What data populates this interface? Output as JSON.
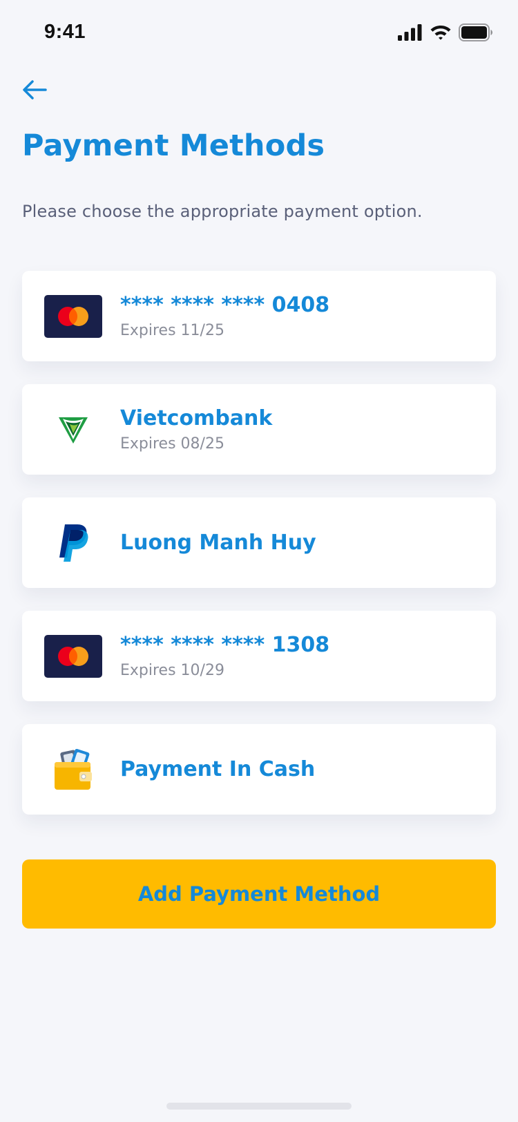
{
  "status_bar": {
    "time": "9:41",
    "icons": [
      "cellular-signal-icon",
      "wifi-icon",
      "battery-icon"
    ]
  },
  "header": {
    "back_icon": "arrow-left-icon",
    "title": "Payment Methods",
    "subtitle": "Please choose the appropriate payment option."
  },
  "methods": [
    {
      "icon": "mastercard-icon",
      "title": "**** **** **** 0408",
      "subtitle": "Expires 11/25"
    },
    {
      "icon": "vietcombank-logo-icon",
      "title": "Vietcombank",
      "subtitle": "Expires 08/25"
    },
    {
      "icon": "paypal-logo-icon",
      "title": "Luong Manh Huy",
      "subtitle": ""
    },
    {
      "icon": "mastercard-icon",
      "title": "**** **** **** 1308",
      "subtitle": "Expires 10/29"
    },
    {
      "icon": "wallet-cash-icon",
      "title": "Payment In Cash",
      "subtitle": ""
    }
  ],
  "add_button": {
    "label": "Add Payment Method"
  },
  "colors": {
    "background": "#f5f6fa",
    "accent": "#1589d8",
    "button": "#ffbb00",
    "card_navy": "#19204a",
    "mastercard_red": "#eb001b",
    "mastercard_orange": "#f79e1b"
  }
}
